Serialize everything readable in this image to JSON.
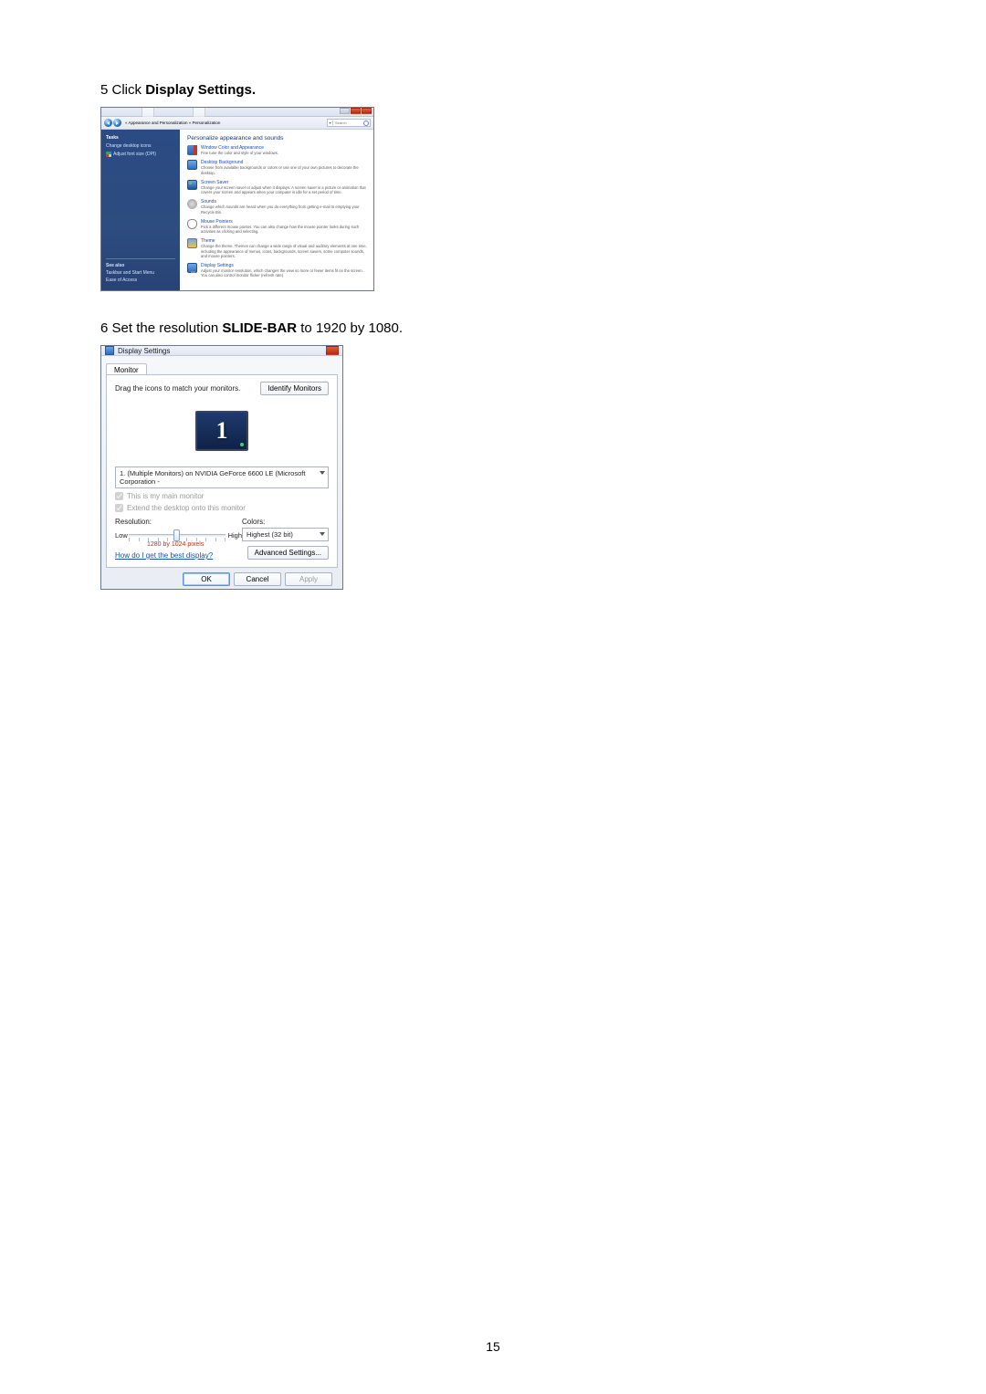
{
  "step5": {
    "prefix": "5 Click ",
    "bold": "Display Settings."
  },
  "win1": {
    "breadcrumb": "« Appearance and Personalization » Personalization",
    "search_btn": "▾",
    "search_hint": "Search",
    "sidebar": {
      "heading": "Tasks",
      "link1": "Change desktop icons",
      "link2": "Adjust font size (DPI)",
      "foot_heading": "See also",
      "foot1": "Taskbar and Start Menu",
      "foot2": "Ease of Access"
    },
    "heading": "Personalize appearance and sounds",
    "items": [
      {
        "title": "Window Color and Appearance",
        "desc": "Fine tune the color and style of your windows."
      },
      {
        "title": "Desktop Background",
        "desc": "Choose from available backgrounds or colors or use one of your own pictures to decorate the desktop."
      },
      {
        "title": "Screen Saver",
        "desc": "Change your screen saver or adjust when it displays. A screen saver is a picture or animation that covers your screen and appears when your computer is idle for a set period of time."
      },
      {
        "title": "Sounds",
        "desc": "Change which sounds are heard when you do everything from getting e-mail to emptying your Recycle Bin."
      },
      {
        "title": "Mouse Pointers",
        "desc": "Pick a different mouse pointer. You can also change how the mouse pointer looks during such activities as clicking and selecting."
      },
      {
        "title": "Theme",
        "desc": "Change the theme. Themes can change a wide range of visual and auditory elements at one time, including the appearance of menus, icons, backgrounds, screen savers, some computer sounds, and mouse pointers."
      },
      {
        "title": "Display Settings",
        "desc": "Adjust your monitor resolution, which changes the view so more or fewer items fit on the screen. You can also control monitor flicker (refresh rate)."
      }
    ]
  },
  "step6": {
    "prefix": "6 Set the resolution ",
    "bold": "SLIDE-BAR",
    "suffix": " to 1920 by 1080."
  },
  "win2": {
    "title": "Display Settings",
    "tab": "Monitor",
    "drag_text": "Drag the icons to match your monitors.",
    "identify_btn": "Identify Monitors",
    "monitor_number": "1",
    "monitor_select": "1. (Multiple Monitors) on NVIDIA GeForce 6600 LE (Microsoft Corporation -",
    "chk_main": "This is my main monitor",
    "chk_extend": "Extend the desktop onto this monitor",
    "reso_label": "Resolution:",
    "reso_low": "Low",
    "reso_high": "High",
    "reso_value": "1280 by 1024 pixels",
    "colors_label": "Colors:",
    "colors_value": "Highest (32 bit)",
    "help_link": "How do I get the best display?",
    "adv_btn": "Advanced Settings...",
    "ok": "OK",
    "cancel": "Cancel",
    "apply": "Apply"
  },
  "page_number": "15"
}
